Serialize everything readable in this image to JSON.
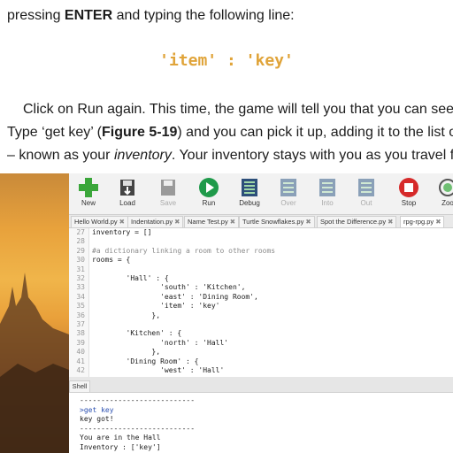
{
  "text": {
    "line1": {
      "pre": "pressing ",
      "bold": "ENTER",
      "post": " and typing the following line:"
    },
    "code": {
      "item": "'item'",
      "sep": " : ",
      "key": "'key'"
    },
    "line2": "Click on Run again. This time, the game will tell you that you can see",
    "line3": {
      "pre": "Type ‘get key’ (",
      "bold": "Figure 5-19",
      "post": ") and you can pick it up, adding it to the list o"
    },
    "line4": {
      "pre": "– known as your ",
      "ital": "inventory",
      "post": ". Your inventory stays with you as you travel f"
    }
  },
  "toolbar": {
    "new": "New",
    "load": "Load",
    "save": "Save",
    "run": "Run",
    "debug": "Debug",
    "over": "Over",
    "into": "Into",
    "out": "Out",
    "stop": "Stop",
    "zoom": "Zoo"
  },
  "colors": {
    "new": "#3aa63a",
    "run": "#1f9a4a",
    "stop": "#d62a2a"
  },
  "tabs": [
    "Hello World.py",
    "Indentation.py",
    "Name Test.py",
    "Turtle Snowflakes.py",
    "Spot the Difference.py",
    "rpg-rpg.py"
  ],
  "tab_close": "✖",
  "editor": {
    "lines": [
      {
        "n": "27",
        "t": "inventory = []"
      },
      {
        "n": "28",
        "t": ""
      },
      {
        "n": "29",
        "t": "#a dictionary linking a room to other rooms"
      },
      {
        "n": "30",
        "t": "rooms = {"
      },
      {
        "n": "31",
        "t": ""
      },
      {
        "n": "32",
        "t": "        'Hall' : {"
      },
      {
        "n": "33",
        "t": "                'south' : 'Kitchen',"
      },
      {
        "n": "34",
        "t": "                'east' : 'Dining Room',"
      },
      {
        "n": "35",
        "t": "                'item' : 'key'"
      },
      {
        "n": "36",
        "t": "              },"
      },
      {
        "n": "37",
        "t": ""
      },
      {
        "n": "38",
        "t": "        'Kitchen' : {"
      },
      {
        "n": "39",
        "t": "                'north' : 'Hall'"
      },
      {
        "n": "40",
        "t": "              },"
      },
      {
        "n": "41",
        "t": "        'Dining Room' : {"
      },
      {
        "n": "42",
        "t": "                'west' : 'Hall'"
      }
    ]
  },
  "shell": {
    "tab": "Shell",
    "lines": [
      "---------------------------",
      ">get key",
      "key got!",
      "---------------------------",
      "You are in the Hall",
      "Inventory : ['key']"
    ]
  }
}
